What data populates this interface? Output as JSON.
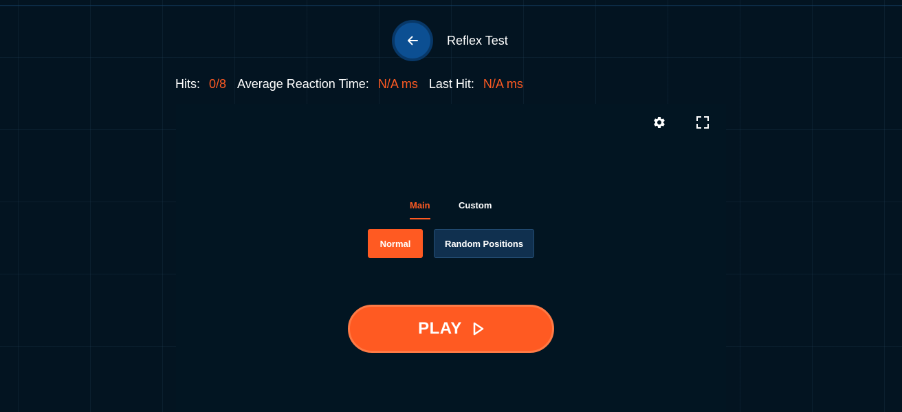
{
  "header": {
    "title": "Reflex Test",
    "back_icon": "arrow-left-icon"
  },
  "stats": {
    "hits_label": "Hits:",
    "hits_value": "0/8",
    "avg_label": "Average Reaction Time:",
    "avg_value": "N/A ms",
    "last_label": "Last Hit:",
    "last_value": "N/A ms"
  },
  "toolbar": {
    "settings_icon": "gear-icon",
    "fullscreen_icon": "fullscreen-icon"
  },
  "tabs": [
    {
      "label": "Main",
      "active": true
    },
    {
      "label": "Custom",
      "active": false
    }
  ],
  "modes": [
    {
      "label": "Normal",
      "selected": true
    },
    {
      "label": "Random Positions",
      "selected": false
    }
  ],
  "play": {
    "label": "PLAY",
    "icon": "play-triangle-icon"
  },
  "colors": {
    "accent": "#ff5a22",
    "background": "#031421",
    "panel": "#021522",
    "back_button": "#0c4f92",
    "secondary_button": "#10304f"
  }
}
